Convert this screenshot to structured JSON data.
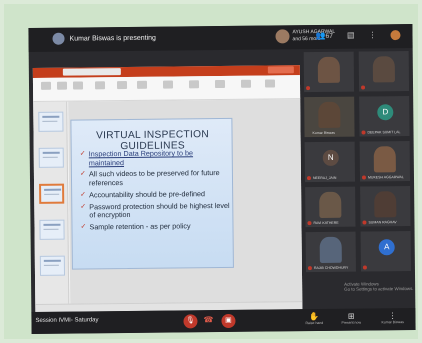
{
  "meeting": {
    "presenter_text": "Kumar Biswas is presenting",
    "presenter_icon": "avatar-icon",
    "people_line1": "AYUSH AGARWAL",
    "people_line2": "and 56 more",
    "people_count": "67"
  },
  "slide": {
    "title": "VIRTUAL INSPECTION GUIDELINES",
    "bullets": [
      "Inspection Data Repository to be maintained",
      "All such videos to be preserved for future references",
      "Accountability should be pre-defined",
      "Password protection should be highest level of encryption",
      "Sample retention - as per policy"
    ]
  },
  "participants": {
    "names": [
      "",
      "",
      "Kumar Biswas",
      "DEEPAK SUMIT LAL",
      "NEERAJ_JAIN",
      "MUKESH AGGARWAL",
      "RAVI KATHERE",
      "SUMAN RAGHAV",
      "RAJIB CHOWDHURY",
      ""
    ],
    "letters": {
      "deepak": "D",
      "neeraj": "N",
      "last": "A"
    }
  },
  "watermark": {
    "line1": "Activate Windows",
    "line2": "Go to Settings to activate Windows."
  },
  "bottombar": {
    "session_label": "Session IVMI- Saturday",
    "controls": {
      "raise_hand": "Raise hand",
      "present_now": "Present now",
      "more": "Kumar Biswas"
    }
  },
  "colors": {
    "accent_red": "#c0392b",
    "ppt_brand": "#c43e1c",
    "teal": "#2e8b7a",
    "blue": "#2f6fd0"
  }
}
